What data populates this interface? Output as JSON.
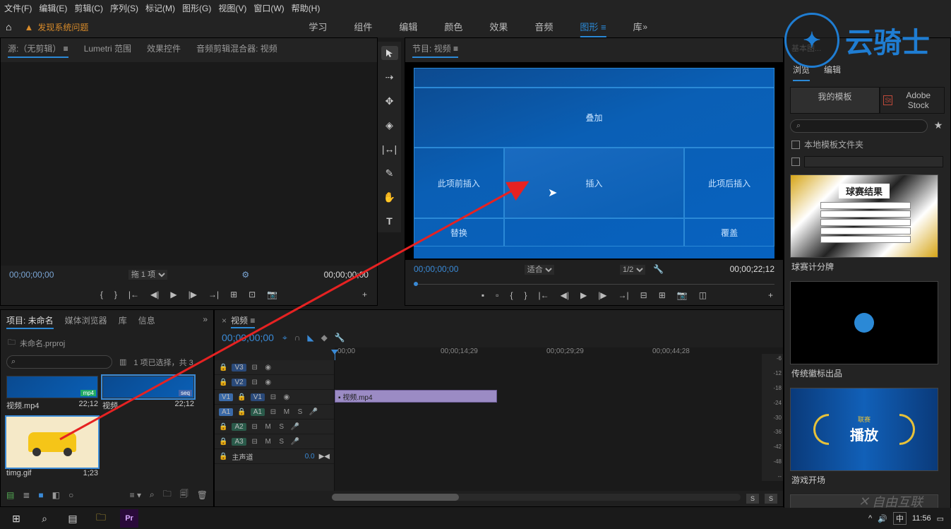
{
  "menu": [
    "文件(F)",
    "编辑(E)",
    "剪辑(C)",
    "序列(S)",
    "标记(M)",
    "图形(G)",
    "视图(V)",
    "窗口(W)",
    "帮助(H)"
  ],
  "warning": "发现系统问题",
  "workspaces": [
    "学习",
    "组件",
    "编辑",
    "颜色",
    "效果",
    "音频",
    "图形",
    "库"
  ],
  "workspace_active_index": 6,
  "brand": "云骑士",
  "source_panel": {
    "tabs": [
      "源:（无剪辑）",
      "Lumetri 范围",
      "效果控件",
      "音频剪辑混合器: 视频"
    ],
    "time_left": "00;00;00;00",
    "btn_label": "拖 1 项",
    "time_right": "00;00;00;00"
  },
  "tools": [
    "▲",
    "↔",
    "⊕",
    "✂",
    "⟷",
    "✎",
    "✋",
    "T"
  ],
  "program": {
    "title": "节目: 视频",
    "overlay_top": "叠加",
    "insert_before": "此项前插入",
    "insert": "插入",
    "insert_after": "此项后插入",
    "replace": "替换",
    "overlay_ic": "覆盖",
    "time_left": "00;00;00;00",
    "fit": "适合",
    "zoom": "1/2",
    "time_right": "00;00;22;12"
  },
  "right": {
    "tabs": [
      "浏览",
      "编辑"
    ],
    "my_templates": "我的模板",
    "stock": "Adobe Stock",
    "search_ph": "⌕",
    "local_folder": "本地模板文件夹",
    "templates": [
      {
        "title": "球赛结果",
        "caption": "球赛计分牌"
      },
      {
        "title": "",
        "caption": "传统徽标出品"
      },
      {
        "title": "播放",
        "sub": "联赛",
        "caption": "游戏开场"
      }
    ]
  },
  "project": {
    "tabs": [
      "项目: 未命名",
      "媒体浏览器",
      "库",
      "信息"
    ],
    "sub": "未命名.prproj",
    "status": "1 项已选择，共 3",
    "bins": [
      {
        "name": "视频.mp4",
        "dur": "22;12"
      },
      {
        "name": "视频",
        "dur": "22;12"
      },
      {
        "name": "timg.gif",
        "dur": "1;23"
      }
    ]
  },
  "timeline": {
    "title": "视频",
    "time": "00;00;00;00",
    "ruler": [
      "00;00",
      "00;00;14;29",
      "00;00;29;29",
      "00;00;44;28"
    ],
    "tracks_v": [
      "V3",
      "V2",
      "V1"
    ],
    "tracks_a": [
      "A1",
      "A2",
      "A3"
    ],
    "master": "主声道",
    "master_val": "0.0",
    "clip": "视频.mp4",
    "meter": [
      "-6",
      "-12",
      "-18",
      "-24",
      "-30",
      "-36",
      "-42",
      "-48",
      "--"
    ]
  },
  "taskbar": {
    "time": "11:56",
    "ime": "中"
  },
  "watermark": "自由互联"
}
